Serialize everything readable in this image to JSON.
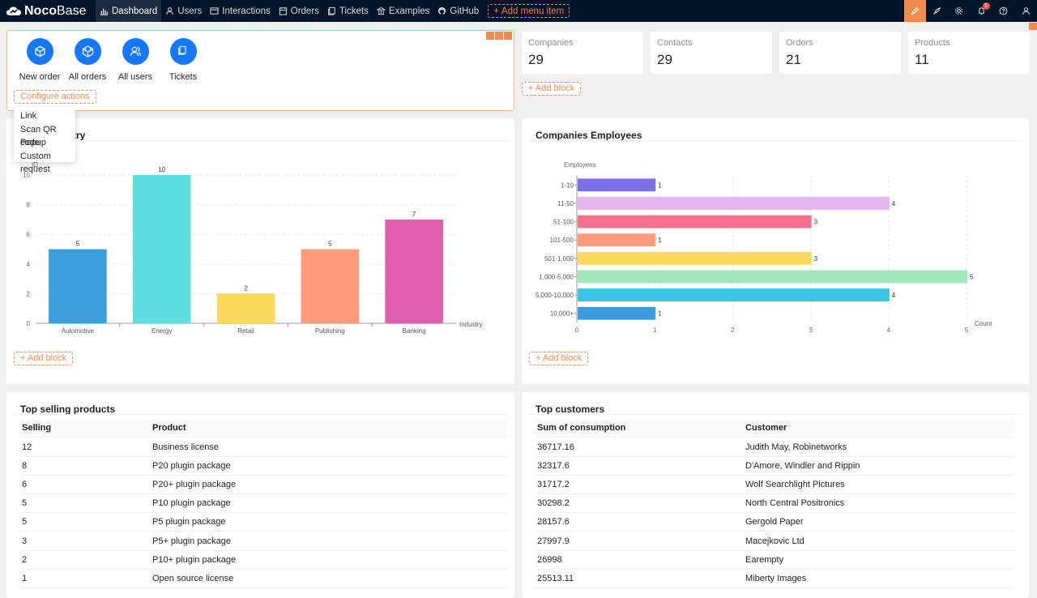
{
  "app": {
    "logo_bold": "Noco",
    "logo_rest": "Base"
  },
  "nav": [
    {
      "label": "Dashboard",
      "icon": "bar-chart-icon"
    },
    {
      "label": "Users",
      "icon": "user-icon"
    },
    {
      "label": "Interactions",
      "icon": "window-icon"
    },
    {
      "label": "Orders",
      "icon": "calendar-icon"
    },
    {
      "label": "Tickets",
      "icon": "copy-icon"
    },
    {
      "label": "Examples",
      "icon": "bank-icon"
    },
    {
      "label": "GitHub",
      "icon": "github-icon"
    }
  ],
  "add_menu_item": "Add menu item",
  "notifications_count": "1",
  "actions": [
    {
      "label": "New order",
      "icon": "cube-icon"
    },
    {
      "label": "All orders",
      "icon": "codesandbox-icon"
    },
    {
      "label": "All users",
      "icon": "users-icon"
    },
    {
      "label": "Tickets",
      "icon": "copy-icon"
    }
  ],
  "configure_actions": "Configure actions",
  "dropdown": [
    "Link",
    "Scan QR code",
    "Popup",
    "Custom request"
  ],
  "stats": [
    {
      "label": "Companies",
      "value": "29"
    },
    {
      "label": "Contacts",
      "value": "29"
    },
    {
      "label": "Orders",
      "value": "21"
    },
    {
      "label": "Products",
      "value": "11"
    }
  ],
  "add_block": "Add block",
  "chart_data": [
    {
      "type": "bar",
      "title_visible": "try",
      "ylabel": "ID",
      "xlabel": "Industry",
      "categories": [
        "Automotive",
        "Energy",
        "Retail",
        "Publishing",
        "Banking"
      ],
      "values": [
        5,
        10,
        2,
        5,
        7
      ],
      "ylim": [
        0,
        10
      ],
      "yticks": [
        0,
        2,
        4,
        6,
        8,
        10
      ],
      "colors": [
        "#3ba0dd",
        "#5edee0",
        "#fbd95c",
        "#fe9c7b",
        "#e05eae"
      ]
    },
    {
      "type": "bar",
      "orientation": "horizontal",
      "title": "Companies Employees",
      "ylabel": "Employees",
      "xlabel": "Count",
      "categories": [
        "1-10",
        "11-50",
        "51-100",
        "101-500",
        "501-1,000",
        "1,000-5,000",
        "5,000-10,000",
        "10,000+"
      ],
      "values": [
        1,
        4,
        3,
        1,
        3,
        5,
        4,
        1
      ],
      "xlim": [
        0,
        5
      ],
      "xticks": [
        0,
        1,
        2,
        3,
        4,
        5
      ],
      "colors": [
        "#7b71e6",
        "#e5b5f0",
        "#f6718f",
        "#fe9c7b",
        "#fbd95c",
        "#a0e6b7",
        "#3cc3e8",
        "#3b9bdc"
      ]
    }
  ],
  "top_products": {
    "title": "Top selling products",
    "headers": [
      "Selling",
      "Product"
    ],
    "rows": [
      [
        "12",
        "Business license"
      ],
      [
        "8",
        "P20 plugin package"
      ],
      [
        "6",
        "P20+ plugin package"
      ],
      [
        "5",
        "P10 plugin package"
      ],
      [
        "5",
        "P5 plugin package"
      ],
      [
        "3",
        "P5+ plugin package"
      ],
      [
        "2",
        "P10+ plugin package"
      ],
      [
        "1",
        "Open source license"
      ]
    ]
  },
  "top_customers": {
    "title": "Top customers",
    "headers": [
      "Sum of consumption",
      "Customer"
    ],
    "rows": [
      [
        "36717.16",
        "Judith May, Robinetworks"
      ],
      [
        "32317.6",
        "D'Amore, Windler and Rippin"
      ],
      [
        "31717.2",
        "Wolf Searchlight Pictures"
      ],
      [
        "30298.2",
        "North Central Positronics"
      ],
      [
        "28157.6",
        "Gergold Paper"
      ],
      [
        "27997.9",
        "Macejkovic Ltd"
      ],
      [
        "26998",
        "Earempty"
      ],
      [
        "25513.11",
        "Miberty Images"
      ]
    ]
  }
}
